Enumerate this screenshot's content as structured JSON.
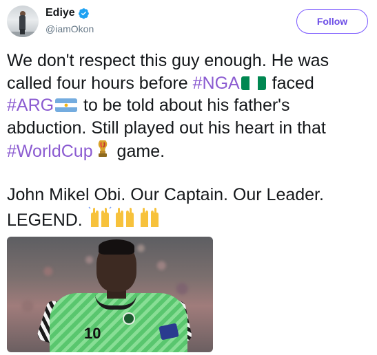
{
  "user": {
    "display_name": "Ediye",
    "handle": "@iamOkon"
  },
  "follow_button": {
    "label": "Follow"
  },
  "tweet": {
    "line1": "We don't respect this guy enough. He was",
    "line2_pre": "called four hours before ",
    "hashtag_nga": "#NGA",
    "line2_post": " faced",
    "hashtag_arg": "#ARG",
    "line3_post": " to be told about his father's",
    "line4": "abduction. Still played out his heart in that",
    "hashtag_worldcup": "#WorldCup",
    "line5_post": " game.",
    "line6": "John Mikel Obi. Our Captain. Our Leader.",
    "line7": "LEGEND."
  },
  "photo": {
    "jersey_number": "10"
  },
  "colors": {
    "link": "#8b5bd1",
    "follow_border": "#7856ff",
    "verified": "#1da1f2",
    "text": "#14171a",
    "secondary": "#657786"
  },
  "icons": [
    "verified-badge-icon",
    "nigeria-flag-icon",
    "argentina-flag-icon",
    "world-cup-trophy-icon",
    "raising-hands-icon"
  ]
}
